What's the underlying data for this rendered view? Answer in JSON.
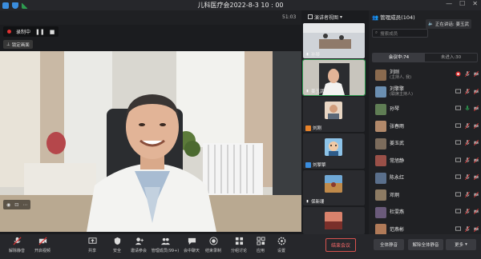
{
  "window": {
    "title": "儿科医疗会2022-8-3 10 : 00",
    "clock": "51:03",
    "layout_label": "演讲者视图"
  },
  "recording": {
    "label": "录制中",
    "pause_icon": "pause-icon",
    "stop_icon": "stop-icon"
  },
  "lock_screen_label": "锁定画面",
  "thumbnails": [
    {
      "name": "孙琴",
      "type": "video"
    },
    {
      "name": "姜玉武",
      "type": "video"
    },
    {
      "name": "刘刚",
      "type": "avatar"
    },
    {
      "name": "刘擎擎",
      "type": "avatar"
    },
    {
      "name": "保新珊",
      "type": "avatar"
    },
    {
      "name": "",
      "type": "avatar"
    }
  ],
  "panel": {
    "title": "管理成员(104)",
    "speaking_label": "正在讲话: 姜玉武",
    "search_placeholder": "搜索成员",
    "tabs": [
      {
        "label": "会议中:74",
        "active": true
      },
      {
        "label": "未进入:30",
        "active": false
      }
    ],
    "members": [
      {
        "name": "刘刚",
        "role": "(主持人, 我)",
        "share_on": true
      },
      {
        "name": "刘擎擎",
        "role": "(联席主持人)",
        "share_on": false
      },
      {
        "name": "孙琴",
        "role": "",
        "share_on": false,
        "mic_green": true
      },
      {
        "name": "张春雨",
        "role": "",
        "share_on": false
      },
      {
        "name": "姜玉武",
        "role": "",
        "share_on": false
      },
      {
        "name": "常旭静",
        "role": "",
        "share_on": false
      },
      {
        "name": "陈永红",
        "role": "",
        "share_on": false
      },
      {
        "name": "邓炯",
        "role": "",
        "share_on": false
      },
      {
        "name": "杜雯燕",
        "role": "",
        "share_on": false
      },
      {
        "name": "范燕彬",
        "role": "",
        "share_on": false
      }
    ]
  },
  "toolbar": {
    "unmute": "解除静音",
    "video": "开启视频",
    "share": "共享",
    "security": "安全",
    "invite": "邀请参会",
    "manage": "管理成员(99+)",
    "chat": "会中聊天",
    "record": "结束录制",
    "breakout": "分组讨论",
    "apps": "应用",
    "settings": "设置",
    "end_meeting": "结束会议",
    "mute_all": "全体静音",
    "unmute_all": "解除全体静音",
    "more": "更多"
  },
  "colors": {
    "accent_green": "#2d9b4f",
    "record_red": "#e03131",
    "end_red": "#d9534f"
  }
}
